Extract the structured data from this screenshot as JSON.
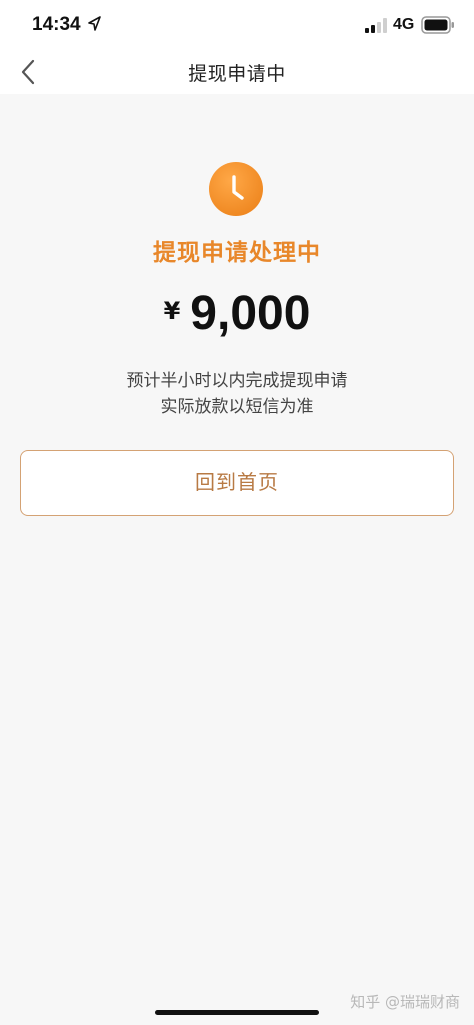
{
  "status_bar": {
    "time": "14:34",
    "network": "4G",
    "location_icon": "location-arrow-icon",
    "signal_icon": "signal-bars-icon",
    "battery_icon": "battery-icon"
  },
  "nav": {
    "back_icon": "chevron-left-icon",
    "title": "提现申请中"
  },
  "main": {
    "status_icon": "clock-icon",
    "status_title": "提现申请处理中",
    "currency_symbol": "¥",
    "amount": "9,000",
    "desc_line1": "预计半小时以内完成提现申请",
    "desc_line2": "实际放款以短信为准",
    "home_button_label": "回到首页"
  },
  "watermark": "知乎 @瑞瑞财商",
  "colors": {
    "accent": "#e8872a",
    "button_border": "#d4a274",
    "button_text": "#b87a44",
    "background": "#f7f7f7"
  }
}
